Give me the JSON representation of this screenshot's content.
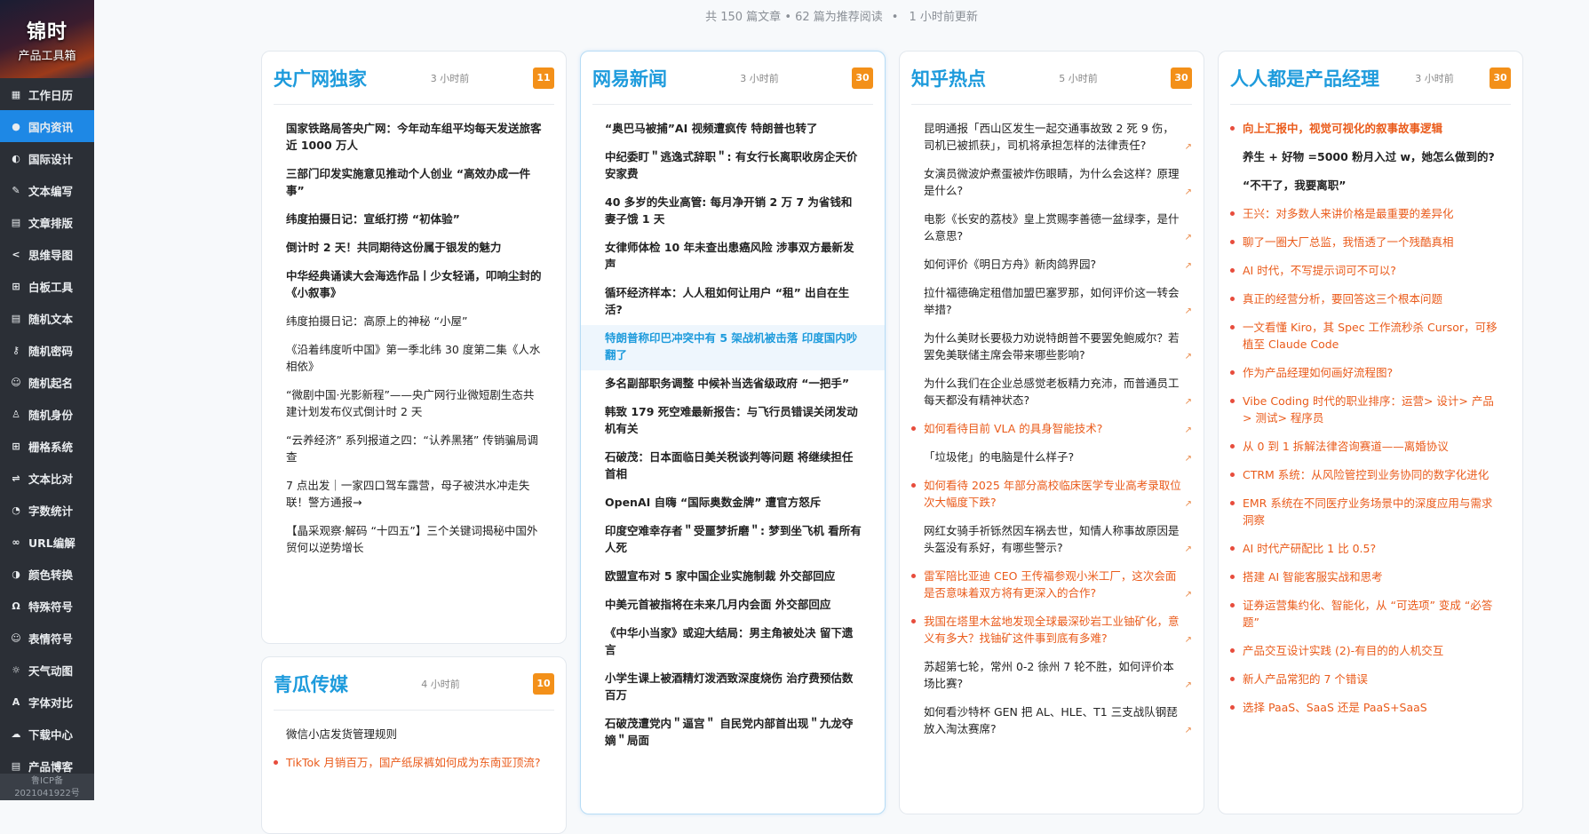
{
  "sidebar": {
    "logo_line1": "锦时",
    "logo_line2": "产品工具箱",
    "items": [
      {
        "label": "工作日历",
        "icon": "calendar-icon"
      },
      {
        "label": "国内资讯",
        "icon": "drop-icon",
        "active": true
      },
      {
        "label": "国际设计",
        "icon": "palette-icon"
      },
      {
        "label": "文本编写",
        "icon": "pen-icon"
      },
      {
        "label": "文章排版",
        "icon": "layout-icon"
      },
      {
        "label": "思维导图",
        "icon": "share-icon"
      },
      {
        "label": "白板工具",
        "icon": "grid-icon"
      },
      {
        "label": "随机文本",
        "icon": "file-icon"
      },
      {
        "label": "随机密码",
        "icon": "key-icon"
      },
      {
        "label": "随机起名",
        "icon": "smile-icon"
      },
      {
        "label": "随机身份",
        "icon": "user-icon"
      },
      {
        "label": "栅格系统",
        "icon": "table-icon"
      },
      {
        "label": "文本比对",
        "icon": "compare-icon"
      },
      {
        "label": "字数统计",
        "icon": "clock-icon"
      },
      {
        "label": "URL编解",
        "icon": "link-icon"
      },
      {
        "label": "颜色转换",
        "icon": "color-icon"
      },
      {
        "label": "特殊符号",
        "icon": "omega-icon"
      },
      {
        "label": "表情符号",
        "icon": "emoji-icon"
      },
      {
        "label": "天气动图",
        "icon": "sun-icon"
      },
      {
        "label": "字体对比",
        "icon": "font-icon"
      },
      {
        "label": "下载中心",
        "icon": "cloud-download-icon"
      },
      {
        "label": "产品博客",
        "icon": "blog-icon"
      }
    ],
    "icp_line1": "鲁ICP备",
    "icp_line2": "2021041922号"
  },
  "status": {
    "summary": "共 150 篇文章 • 62 篇为推荐阅读",
    "sep": "•",
    "updated": "1 小时前更新"
  },
  "cards": [
    {
      "title": "央广网独家",
      "time": "3 小时前",
      "count": "11",
      "items": [
        {
          "text": "国家铁路局答央广网：今年动车组平均每天发送旅客近 1000 万人",
          "bold": true
        },
        {
          "text": "三部门印发实施意见推动个人创业 “高效办成一件事”",
          "bold": true
        },
        {
          "text": "纬度拍摄日记：宣纸打捞 “初体验”",
          "bold": true
        },
        {
          "text": "倒计时 2 天！共同期待这份属于银发的魅力",
          "bold": true
        },
        {
          "text": "中华经典诵读大会海选作品丨少女轻诵，叩响尘封的《小叙事》",
          "bold": true
        },
        {
          "text": "纬度拍摄日记：高原上的神秘 “小屋”"
        },
        {
          "text": "《沿着纬度听中国》第一季北纬 30 度第二集《人水相依》"
        },
        {
          "text": "“微剧中国·光影新程”——央广网行业微短剧生态共建计划发布仪式倒计时 2 天"
        },
        {
          "text": "“云养经济” 系列报道之四：“认养黑猪” 传销骗局调查"
        },
        {
          "text": "7 点出发｜一家四口驾车露营，母子被洪水冲走失联！警方通报→"
        },
        {
          "text": "【晶采观察·解码 “十四五”】三个关键词揭秘中国外贸何以逆势增长"
        }
      ]
    },
    {
      "title": "网易新闻",
      "time": "3 小时前",
      "count": "30",
      "items": [
        {
          "text": "“奥巴马被捕”AI 视频遭疯传 特朗普也转了",
          "bold": true
        },
        {
          "text": "中纪委盯＂逃逸式辞职＂: 有女行长离职收房企天价安家费",
          "bold": true
        },
        {
          "text": "40 多岁的失业高管: 每月净开销 2 万 7 为省钱和妻子饿 1 天",
          "bold": true
        },
        {
          "text": "女律师体检 10 年未查出患癌风险 涉事双方最新发声",
          "bold": true
        },
        {
          "text": "循环经济样本：人人租如何让用户 “租” 出自在生活?",
          "bold": true
        },
        {
          "text": "特朗普称印巴冲突中有 5 架战机被击落 印度国内吵翻了",
          "bold": true,
          "selected": true
        },
        {
          "text": "多名副部职务调整 中候补当选省级政府 “一把手”",
          "bold": true
        },
        {
          "text": "韩致 179 死空难最新报告：与飞行员错误关闭发动机有关",
          "bold": true
        },
        {
          "text": "石破茂：日本面临日美关税谈判等问题 将继续担任首相",
          "bold": true
        },
        {
          "text": "OpenAI 自嗨 “国际奥数金牌” 遭官方怒斥",
          "bold": true
        },
        {
          "text": "印度空难幸存者＂受噩梦折磨＂: 梦到坐飞机 看所有人死",
          "bold": true
        },
        {
          "text": "欧盟宣布对 5 家中国企业实施制裁 外交部回应",
          "bold": true
        },
        {
          "text": "中美元首被指将在未来几月内会面 外交部回应",
          "bold": true
        },
        {
          "text": "《中华小当家》或迎大结局：男主角被处决 留下遗言",
          "bold": true
        },
        {
          "text": "小学生课上被酒精灯泼洒致深度烧伤 治疗费预估数百万",
          "bold": true
        },
        {
          "text": "石破茂遭党内＂逼宫＂ 自民党内部首出现＂九龙夺嫡＂局面",
          "bold": true
        }
      ]
    },
    {
      "title": "知乎热点",
      "time": "5 小时前",
      "count": "30",
      "items": [
        {
          "text": "昆明通报「西山区发生一起交通事故致 2 死 9 伤，司机已被抓获」，司机将承担怎样的法律责任?",
          "arrow": true
        },
        {
          "text": "女演员微波炉煮蛋被炸伤眼睛，为什么会这样？原理是什么?",
          "arrow": true
        },
        {
          "text": "电影《长安的荔枝》皇上赏赐李善德一盆绿李，是什么意思?",
          "arrow": true
        },
        {
          "text": "如何评价《明日方舟》新肉鸽界园?",
          "arrow": true
        },
        {
          "text": "拉什福德确定租借加盟巴塞罗那，如何评价这一转会举措?",
          "arrow": true
        },
        {
          "text": "为什么美财长要极力劝说特朗普不要罢免鲍威尔？若罢免美联储主席会带来哪些影响?",
          "arrow": true
        },
        {
          "text": "为什么我们在企业总感觉老板精力充沛，而普通员工每天都没有精神状态?",
          "arrow": true
        },
        {
          "text": "如何看待目前 VLA 的具身智能技术?",
          "hot": true,
          "arrow": true
        },
        {
          "text": "「垃圾佬」的电脑是什么样子?",
          "arrow": true
        },
        {
          "text": "如何看待 2025 年部分高校临床医学专业高考录取位次大幅度下跌?",
          "hot": true,
          "arrow": true
        },
        {
          "text": "网红女骑手祈铄然因车祸去世，知情人称事故原因是头盔没有系好，有哪些警示?",
          "arrow": true
        },
        {
          "text": "雷军陪比亚迪 CEO 王传福参观小米工厂，这次会面是否意味着双方将有更深入的合作?",
          "hot": true,
          "arrow": true
        },
        {
          "text": "我国在塔里木盆地发现全球最深砂岩工业铀矿化，意义有多大？找铀矿这件事到底有多难?",
          "hot": true,
          "arrow": true
        },
        {
          "text": "苏超第七轮，常州 0-2 徐州 7 轮不胜，如何评价本场比赛?",
          "arrow": true
        },
        {
          "text": "如何看沙特杯 GEN 把 AL、HLE、T1 三支战队钢琵放入淘汰赛席?",
          "arrow": true
        }
      ]
    },
    {
      "title": "人人都是产品经理",
      "time": "3 小时前",
      "count": "30",
      "items": [
        {
          "text": "向上汇报中，视觉可视化的叙事故事逻辑",
          "hot": true,
          "bold": true
        },
        {
          "text": "养生 + 好物 =5000 粉月入过 w，她怎么做到的?",
          "bold": true
        },
        {
          "text": "“不干了，我要离职”",
          "bold": true
        },
        {
          "text": "王兴：对多数人来讲价格是最重要的差异化",
          "hot": true
        },
        {
          "text": "聊了一圈大厂总监，我悟透了一个残酷真相",
          "hot": true
        },
        {
          "text": "AI 时代，不写提示词可不可以?",
          "hot": true
        },
        {
          "text": "真正的经营分析，要回答这三个根本问题",
          "hot": true
        },
        {
          "text": "一文看懂 Kiro，其 Spec 工作流秒杀 Cursor，可移植至 Claude Code",
          "hot": true
        },
        {
          "text": "作为产品经理如何画好流程图?",
          "hot": true
        },
        {
          "text": "Vibe Coding 时代的职业排序：运营> 设计> 产品> 测试> 程序员",
          "hot": true
        },
        {
          "text": "从 0 到 1 拆解法律咨询赛道——离婚协议",
          "hot": true
        },
        {
          "text": "CTRM 系统：从风险管控到业务协同的数字化进化",
          "hot": true
        },
        {
          "text": "EMR 系统在不同医疗业务场景中的深度应用与需求洞察",
          "hot": true
        },
        {
          "text": "AI 时代产研配比 1 比 0.5?",
          "hot": true
        },
        {
          "text": "搭建 AI 智能客服实战和思考",
          "hot": true
        },
        {
          "text": "证券运营集约化、智能化，从 “可选项” 变成 “必答题”",
          "hot": true
        },
        {
          "text": "产品交互设计实践 (2)-有目的的人机交互",
          "hot": true
        },
        {
          "text": "新人产品常犯的 7 个错误",
          "hot": true
        },
        {
          "text": "选择 PaaS、SaaS 还是 PaaS+SaaS",
          "hot": true
        }
      ]
    },
    {
      "title": "青瓜传媒",
      "time": "4 小时前",
      "count": "10",
      "items": [
        {
          "text": "微信小店发货管理规则"
        },
        {
          "text": "TikTok 月销百万，国产纸尿裤如何成为东南亚顶流?",
          "hot": true
        }
      ]
    }
  ]
}
